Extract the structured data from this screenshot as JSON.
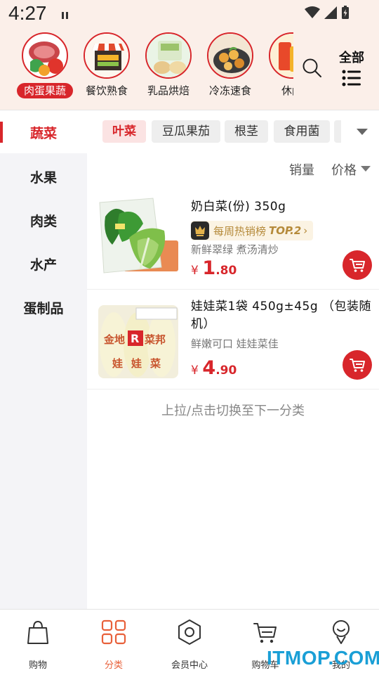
{
  "status_bar": {
    "time": "4:27"
  },
  "header": {
    "categories": [
      {
        "label": "肉蛋果蔬",
        "active": true
      },
      {
        "label": "餐饮熟食",
        "active": false
      },
      {
        "label": "乳品烘焙",
        "active": false
      },
      {
        "label": "冷冻速食",
        "active": false
      },
      {
        "label": "休闲",
        "active": false
      }
    ],
    "all_label": "全部"
  },
  "sidebar": {
    "items": [
      "蔬菜",
      "水果",
      "肉类",
      "水产",
      "蛋制品"
    ],
    "active_index": 0
  },
  "subtabs": {
    "items": [
      "叶菜",
      "豆瓜果茄",
      "根茎",
      "食用菌"
    ],
    "active_index": 0
  },
  "sort": {
    "sales_label": "销量",
    "price_label": "价格"
  },
  "products": [
    {
      "name": "奶白菜(份) 350g",
      "rank_text": "每周热销榜",
      "rank_badge": "TOP.2",
      "rank_chevron": "›",
      "desc": "新鲜翠绿 煮汤清炒",
      "currency": "¥",
      "price_int": "1",
      "price_dec": ".80"
    },
    {
      "name": "娃娃菜1袋 450g±45g （包装随机）",
      "desc": "鲜嫩可口 娃娃菜佳",
      "currency": "¥",
      "price_int": "4",
      "price_dec": ".90",
      "package_text": {
        "line1": "金地",
        "brand": "菜邦",
        "line2": "娃娃菜"
      }
    }
  ],
  "load_more_text": "上拉/点击切换至下一分类",
  "bottom_nav": {
    "items": [
      {
        "label": "购物",
        "icon": "shopping-bag-icon"
      },
      {
        "label": "分类",
        "icon": "grid-icon"
      },
      {
        "label": "会员中心",
        "icon": "hexagon-icon"
      },
      {
        "label": "购物车",
        "icon": "cart-icon"
      },
      {
        "label": "我的",
        "icon": "person-icon"
      }
    ],
    "active_index": 1
  },
  "watermark": "ITMOP.COM",
  "colors": {
    "accent": "#d8262b",
    "nav_active": "#e8603a",
    "header_bg": "#fbefe9",
    "sidebar_bg": "#f4f4f7"
  }
}
